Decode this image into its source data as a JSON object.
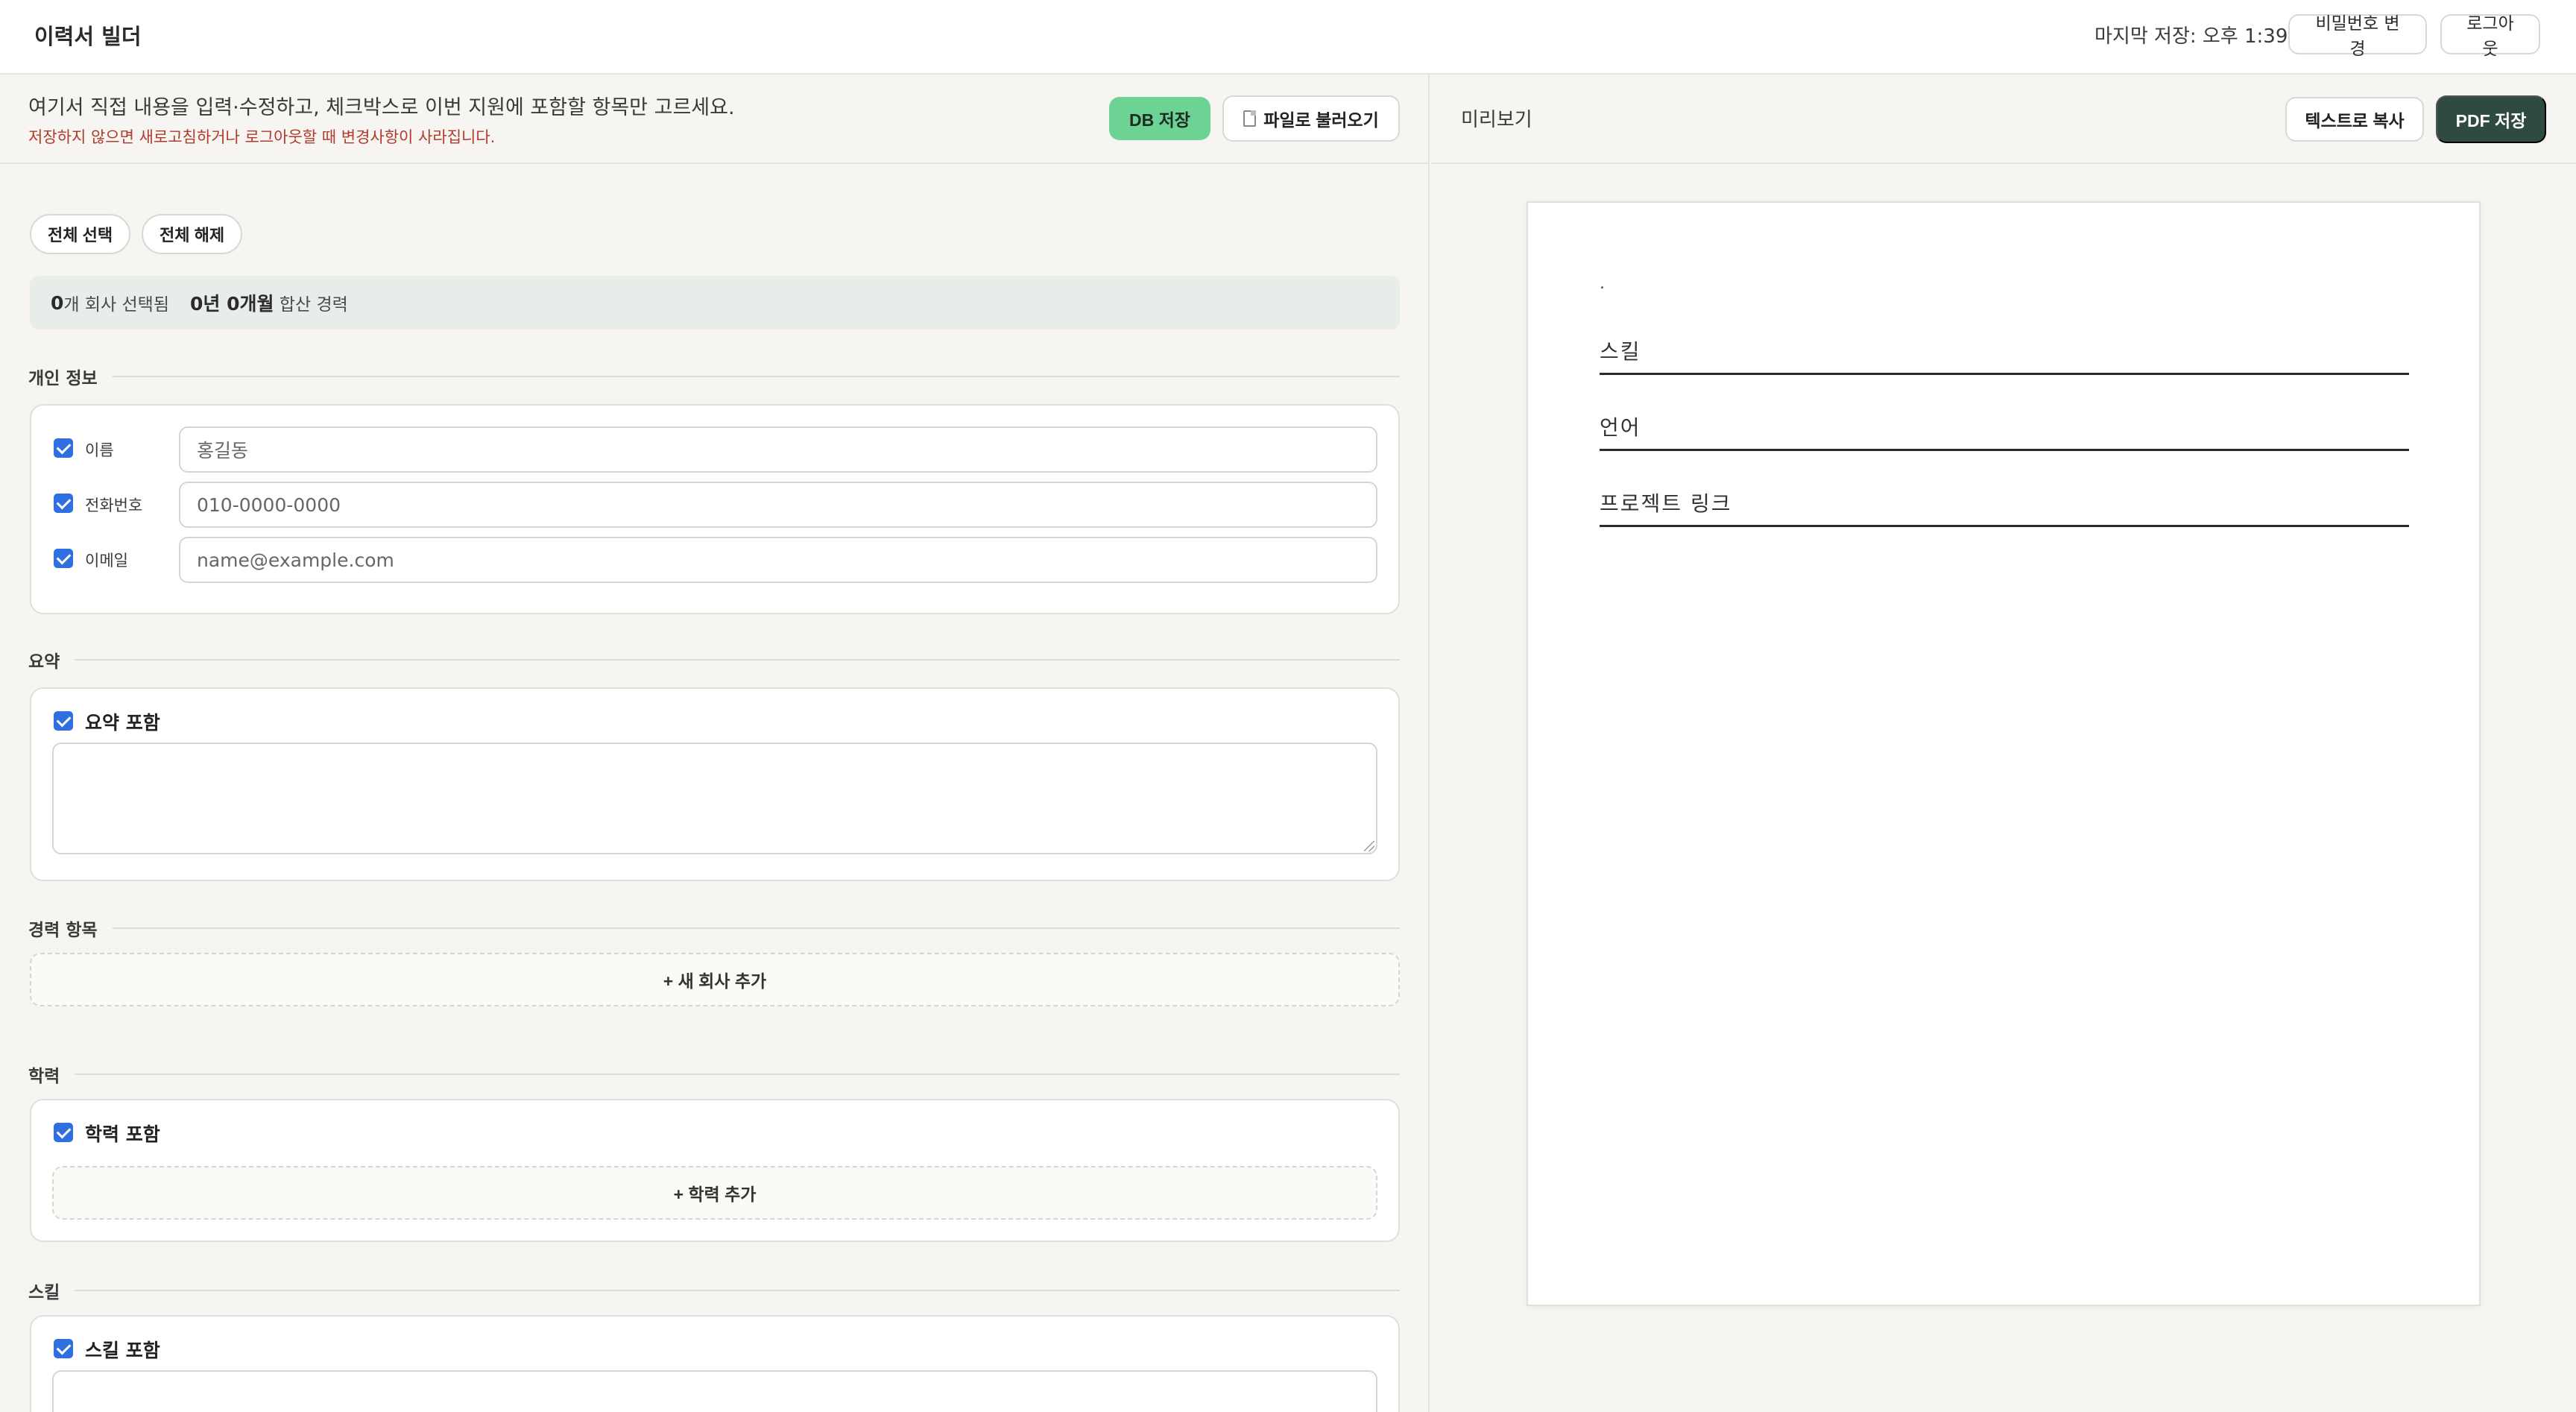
{
  "header": {
    "app_title": "이력서 빌더",
    "last_saved": "마지막 저장: 오후 1:39",
    "change_password": "비밀번호 변경",
    "logout": "로그아웃"
  },
  "editor": {
    "intro": "여기서 직접 내용을 입력·수정하고, 체크박스로 이번 지원에 포함할 항목만 고르세요.",
    "warning": "저장하지 않으면 새로고침하거나 로그아웃할 때 변경사항이 사라집니다.",
    "db_save": "DB 저장",
    "load_file": "파일로 불러오기",
    "select_all": "전체 선택",
    "deselect_all": "전체 해제",
    "stats": {
      "company_count": "0",
      "company_suffix": "개 회사 선택됨",
      "total_duration": "0년 0개월",
      "total_suffix": " 합산 경력"
    },
    "personal": {
      "title": "개인 정보",
      "name_label": "이름",
      "name_placeholder": "홍길동",
      "phone_label": "전화번호",
      "phone_placeholder": "010-0000-0000",
      "email_label": "이메일",
      "email_placeholder": "name@example.com",
      "name_checked": true,
      "phone_checked": true,
      "email_checked": true
    },
    "summary": {
      "title": "요약",
      "include_label": "요약 포함",
      "checked": true,
      "text": ""
    },
    "experience": {
      "title": "경력 항목",
      "add_label": "+ 새 회사 추가"
    },
    "education": {
      "title": "학력",
      "include_label": "학력 포함",
      "checked": true,
      "add_label": "+ 학력 추가"
    },
    "skills": {
      "title": "스킬",
      "include_label": "스킬 포함",
      "checked": true
    }
  },
  "preview": {
    "title": "미리보기",
    "copy_text": "텍스트로 복사",
    "pdf_save": "PDF 저장",
    "name_placeholder": ".",
    "sections": [
      "스킬",
      "언어",
      "프로젝트 링크"
    ]
  },
  "colors": {
    "accent_checkbox": "#2f6fe0",
    "db_button": "#6cd394",
    "pdf_button": "#2f4a40",
    "warning_text": "#b23a2a"
  }
}
